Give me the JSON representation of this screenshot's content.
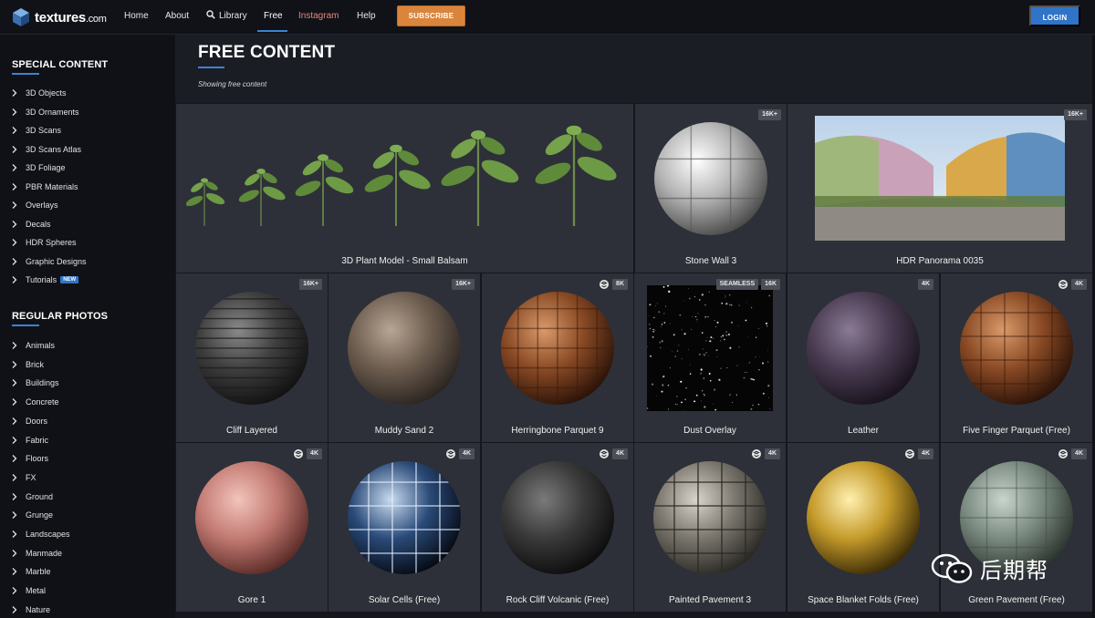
{
  "nav": {
    "logo_text": "textures",
    "logo_suffix": ".com",
    "links": [
      "Home",
      "About",
      "Library",
      "Free",
      "Instagram",
      "Help"
    ],
    "subscribe_label": "SUBSCRIBE",
    "login_label": "LOGIN"
  },
  "sidebar": {
    "special_heading": "SPECIAL CONTENT",
    "special_items": [
      "3D Objects",
      "3D Ornaments",
      "3D Scans",
      "3D Scans Atlas",
      "3D Foliage",
      "PBR Materials",
      "Overlays",
      "Decals",
      "HDR Spheres",
      "Graphic Designs",
      "Tutorials"
    ],
    "new_badge": "NEW",
    "regular_heading": "REGULAR PHOTOS",
    "regular_items": [
      "Animals",
      "Brick",
      "Buildings",
      "Concrete",
      "Doors",
      "Fabric",
      "Floors",
      "FX",
      "Ground",
      "Grunge",
      "Landscapes",
      "Manmade",
      "Marble",
      "Metal",
      "Nature"
    ]
  },
  "main": {
    "title": "FREE CONTENT",
    "subtitle": "Showing free content"
  },
  "cards": [
    {
      "label": "3D Plant Model - Small Balsam",
      "badges": []
    },
    {
      "label": "Stone Wall 3",
      "badges": [
        "16K+"
      ]
    },
    {
      "label": "HDR Panorama 0035",
      "badges": [
        "16K+"
      ]
    },
    {
      "label": "Cliff Layered",
      "badges": [
        "16K+"
      ]
    },
    {
      "label": "Muddy Sand 2",
      "badges": [
        "16K+"
      ]
    },
    {
      "label": "Herringbone Parquet 9",
      "badges": [
        "8K"
      ],
      "sub": true
    },
    {
      "label": "Dust Overlay",
      "badges": [
        "SEAMLESS",
        "16K"
      ]
    },
    {
      "label": "Leather",
      "badges": [
        "4K"
      ]
    },
    {
      "label": "Five Finger Parquet (Free)",
      "badges": [
        "4K"
      ],
      "sub": true
    },
    {
      "label": "Gore 1",
      "badges": [
        "4K"
      ],
      "sub": true
    },
    {
      "label": "Solar Cells (Free)",
      "badges": [
        "4K"
      ],
      "sub": true
    },
    {
      "label": "Rock Cliff Volcanic (Free)",
      "badges": [
        "4K"
      ],
      "sub": true
    },
    {
      "label": "Painted Pavement 3",
      "badges": [
        "4K"
      ],
      "sub": true
    },
    {
      "label": "Space Blanket Folds (Free)",
      "badges": [
        "4K"
      ],
      "sub": true
    },
    {
      "label": "Green Pavement (Free)",
      "badges": [
        "4K"
      ],
      "sub": true
    }
  ],
  "watermark_text": "后期帮",
  "colors": {
    "accent": "#3b82d4",
    "subscribe": "#d9853b",
    "instagram": "#e8867a"
  }
}
